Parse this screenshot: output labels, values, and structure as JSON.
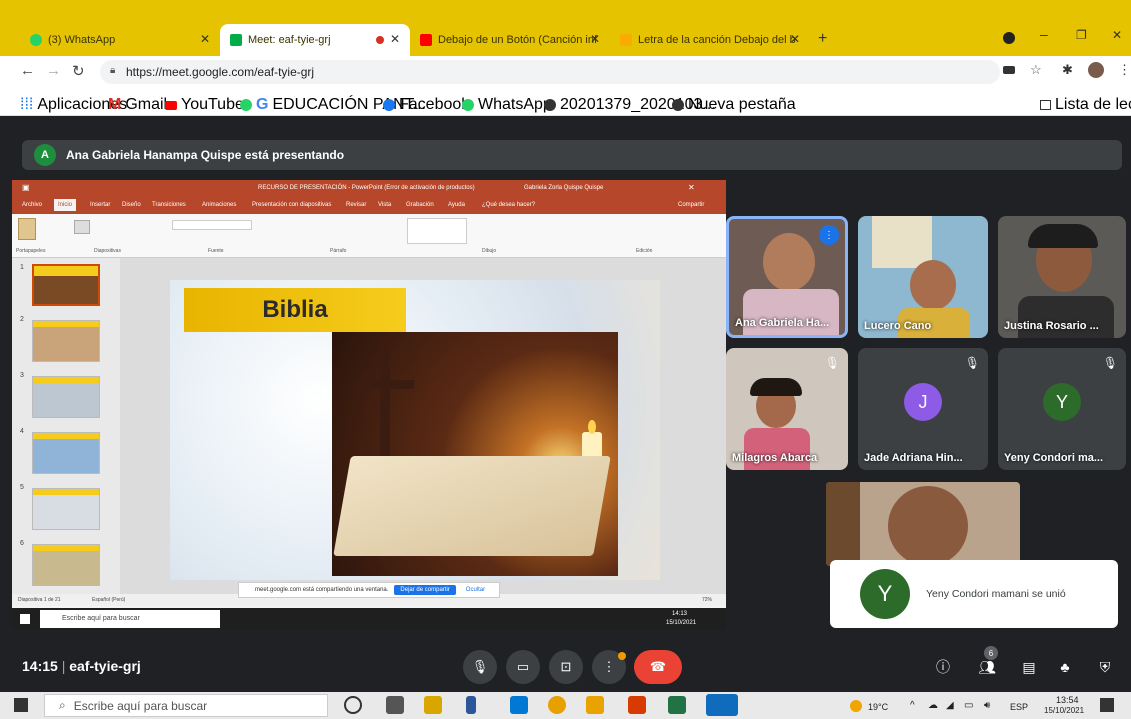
{
  "browser": {
    "tabs": [
      {
        "title": "(3) WhatsApp",
        "color": "#25d366"
      },
      {
        "title": "Meet: eaf-tyie-grj",
        "color": "#00ac47"
      },
      {
        "title": "Debajo de un Botón (Canción inf",
        "color": "#ff0000"
      },
      {
        "title": "Letra de la canción Debajo del b",
        "color": "#f9ab00"
      }
    ],
    "new_tab_label": "+",
    "url": "https://meet.google.com/eaf-tyie-grj",
    "bookmarks": [
      "Aplicaciones",
      "Gmail",
      "YouTube",
      "EDUCACIÓN PANT...",
      "Facebook",
      "WhatsApp",
      "20201379_2020103...",
      "Nueva pestaña"
    ],
    "reading_list": "Lista de lectura"
  },
  "meet": {
    "presenter_initial": "A",
    "presenter_text": "Ana Gabriela Hanampa Quispe está presentando",
    "time": "14:15",
    "code": "eaf-tyie-grj",
    "toast": {
      "initial": "Y",
      "message": "Yeny Condori mamani se unió"
    },
    "participants": [
      {
        "name": "Ana Gabriela Ha...",
        "type": "video",
        "speaking": true
      },
      {
        "name": "Lucero Cano",
        "type": "video"
      },
      {
        "name": "Justina Rosario ...",
        "type": "video"
      },
      {
        "name": "Milagros Abarca",
        "type": "video",
        "muted": true
      },
      {
        "name": "Jade Adriana Hin...",
        "type": "avatar",
        "initial": "J",
        "color": "#8e5be6",
        "muted": true
      },
      {
        "name": "Yeny Condori ma...",
        "type": "avatar",
        "initial": "Y",
        "color": "#2d6b2a",
        "muted": true
      }
    ],
    "people_count": "6"
  },
  "powerpoint": {
    "window_title": "RECURSO DE PRESENTACIÓN - PowerPoint (Error de activación de productos)",
    "user": "Gabriela Zorla Quispe Quispe",
    "menu": [
      "Archivo",
      "Inicio",
      "Insertar",
      "Diseño",
      "Transiciones",
      "Animaciones",
      "Presentación con diapositivas",
      "Revisar",
      "Vista",
      "Grabación",
      "Ayuda",
      "¿Qué desea hacer?"
    ],
    "share_button": "Compartir",
    "ribbon_groups": [
      "Portapapeles",
      "Diapositivas",
      "Fuente",
      "Párrafo",
      "Dibujo",
      "Edición"
    ],
    "slide_numbers": [
      "1",
      "2",
      "3",
      "4",
      "5",
      "6"
    ],
    "slide_title": "Biblia",
    "status": "Diapositiva 1 de 21",
    "status_lang": "Español (Perú)",
    "zoom": "72%",
    "share_notice": "meet.google.com está compartiendo una ventana.",
    "stop_sharing": "Dejar de compartir",
    "hide": "Ocultar",
    "inner_search": "Escribe aquí para buscar",
    "inner_clock_time": "14:13",
    "inner_clock_date": "15/10/2021"
  },
  "taskbar": {
    "search_placeholder": "Escribe aquí para buscar",
    "weather": "19°C",
    "language": "ESP",
    "clock_time": "13:54",
    "clock_date": "15/10/2021"
  }
}
